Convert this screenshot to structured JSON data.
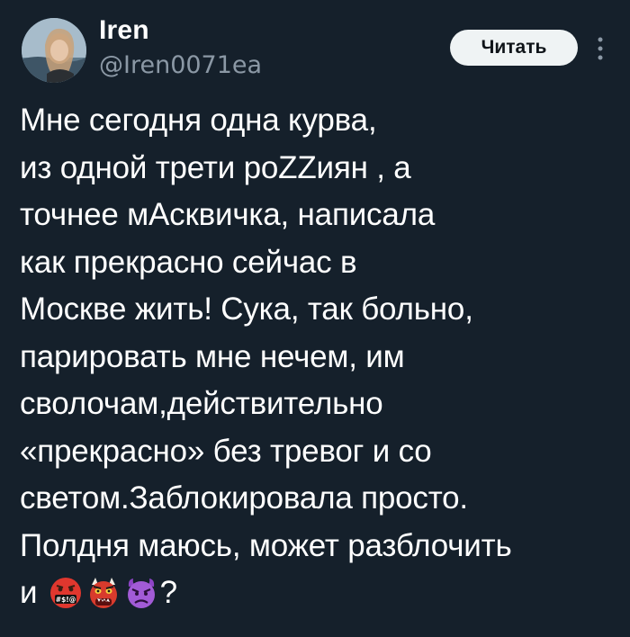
{
  "tweet": {
    "author": {
      "display_name": "Iren",
      "handle": "@Iren0071ea"
    },
    "follow_label": "Читать",
    "text_lines": "Мне сегодня одна курва,\nиз одной трети  poZZиян , а\nточнее мАсквичка, написала\nкак прекрасно сейчас в\nМоскве жить! Сука, так больно,\nпарировать мне нечем, им\nсволочам,действительно\n«прекрасно» без тревог и со\nсветом.Заблокировала просто.\nПолдня маюсь, может разблочить",
    "last_line_prefix": "и",
    "last_line_suffix": "?",
    "emojis": [
      "face-with-symbols-icon",
      "ogre-icon",
      "angry-devil-icon"
    ]
  },
  "colors": {
    "background": "#15202b",
    "text": "#ffffff",
    "muted": "#8b98a5",
    "button_bg": "#eff3f4"
  }
}
